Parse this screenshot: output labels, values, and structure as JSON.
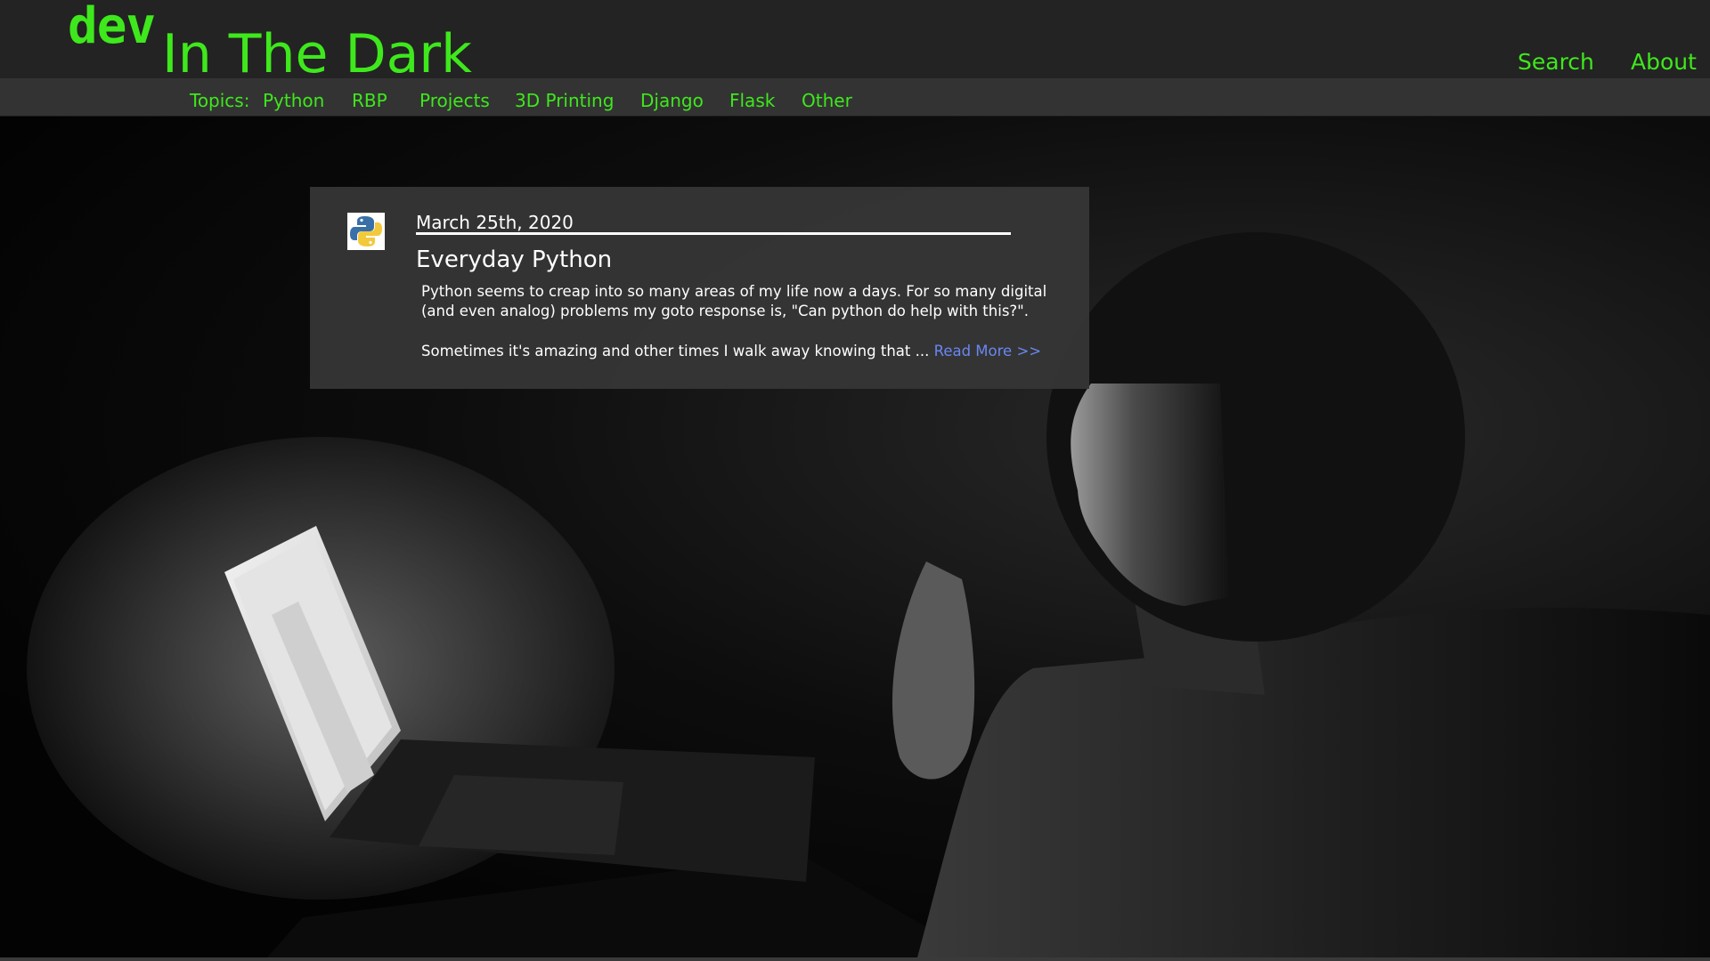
{
  "header": {
    "logo_prefix": "dev",
    "site_title": "In The Dark",
    "nav": {
      "search": "Search",
      "about": "About"
    }
  },
  "topics": {
    "label": "Topics:",
    "items": [
      "Python",
      "RBP",
      "Projects",
      "3D Printing",
      "Django",
      "Flask",
      "Other"
    ]
  },
  "post": {
    "icon": "python-logo-icon",
    "date": "March 25th, 2020",
    "title": "Everyday Python",
    "paragraph1": "Python seems to creap into so many areas of my life now a days. For so many digital (and even analog) problems my goto response is, \"Can python do help with this?\".",
    "paragraph2": "Sometimes it's amazing and other times I walk away knowing that ... ",
    "read_more": "Read More >>"
  },
  "colors": {
    "accent_green": "#3ee81c",
    "link_blue": "#6a86f0",
    "header_bg": "#232323",
    "topic_bar_bg": "#333333",
    "card_bg": "#363636"
  },
  "hero_image": "person-at-laptop-in-dark"
}
